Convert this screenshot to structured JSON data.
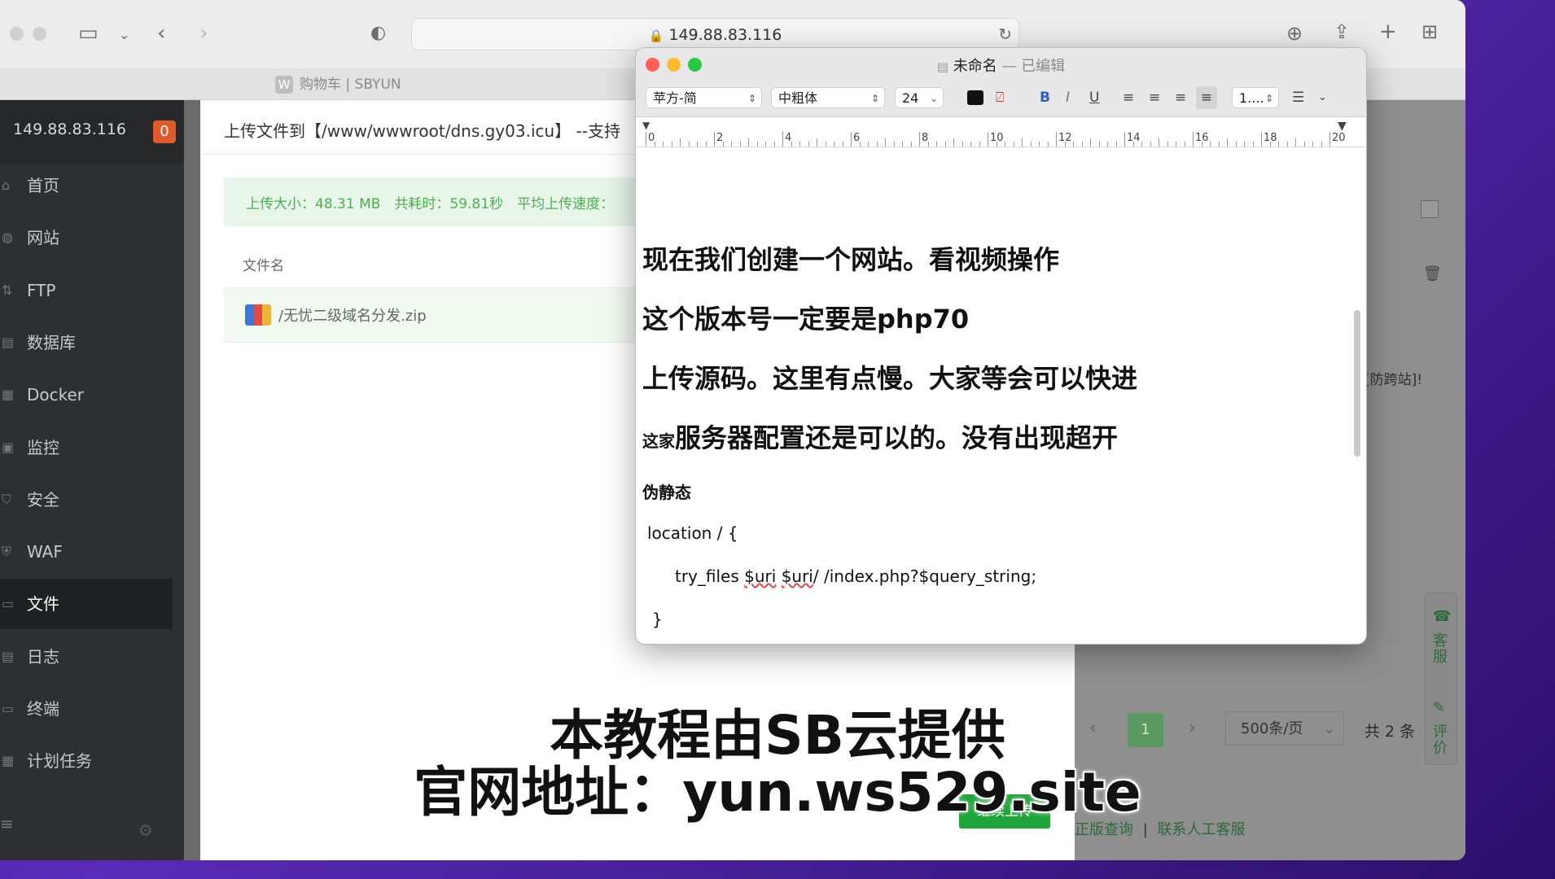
{
  "browser": {
    "url": "149.88.83.116",
    "tab_title": "购物车 | SBYUN",
    "tab_favicon": "W"
  },
  "sidebar": {
    "host": "149.88.83.116",
    "badge": "0",
    "items": [
      {
        "label": "首页",
        "icon": "home-icon"
      },
      {
        "label": "网站",
        "icon": "globe-icon"
      },
      {
        "label": "FTP",
        "icon": "ftp-icon"
      },
      {
        "label": "数据库",
        "icon": "database-icon"
      },
      {
        "label": "Docker",
        "icon": "docker-icon"
      },
      {
        "label": "监控",
        "icon": "monitor-icon"
      },
      {
        "label": "安全",
        "icon": "shield-icon"
      },
      {
        "label": "WAF",
        "icon": "waf-icon"
      },
      {
        "label": "文件",
        "icon": "folder-icon"
      },
      {
        "label": "日志",
        "icon": "log-icon"
      },
      {
        "label": "终端",
        "icon": "terminal-icon"
      },
      {
        "label": "计划任务",
        "icon": "calendar-icon"
      }
    ],
    "active_index": 8
  },
  "upload_modal": {
    "title": "上传文件到【/www/wwwroot/dns.gy03.icu】 --支持",
    "info": "上传大小：48.31 MB　共耗时：59.81秒　平均上传速度：",
    "col_filename": "文件名",
    "file": "/无忧二级域名分发.zip",
    "continue_button": "继续上传"
  },
  "background_panel": {
    "fragment_1": "[防跨站]!",
    "pager_current": "1",
    "page_size": "500条/页",
    "total": "共 2 条",
    "link_1": "正版查询",
    "link_sep": "|",
    "link_2": "联系人工客服",
    "float_service": "客服",
    "float_rate": "评价"
  },
  "textedit": {
    "title": "未命名",
    "title_sep": " — ",
    "title_status": "已编辑",
    "font_family": "苹方-简",
    "font_style": "中粗体",
    "font_size": "24",
    "spacing": "1....",
    "ruler_labels": [
      "0",
      "2",
      "4",
      "6",
      "8",
      "10",
      "12",
      "14",
      "16",
      "18",
      "20"
    ],
    "lines": [
      "现在我们创建一个网站。看视频操作",
      "这个版本号一定要是php70",
      "上传源码。这里有点慢。大家等会可以快进"
    ],
    "line4_small": "这家",
    "line4_big": "服务器配置还是可以的。没有出现超开",
    "line5": "伪静态",
    "code1": "location / {",
    "code2_pre": "try_files ",
    "code2_uri1": "$uri",
    "code2_mid": " ",
    "code2_uri2": "$uri",
    "code2_post": "/ /index.php?$query_string;",
    "code3": "}"
  },
  "captions": {
    "line1": "本教程由SB云提供",
    "line2": "官网地址：yun.ws529.site"
  }
}
